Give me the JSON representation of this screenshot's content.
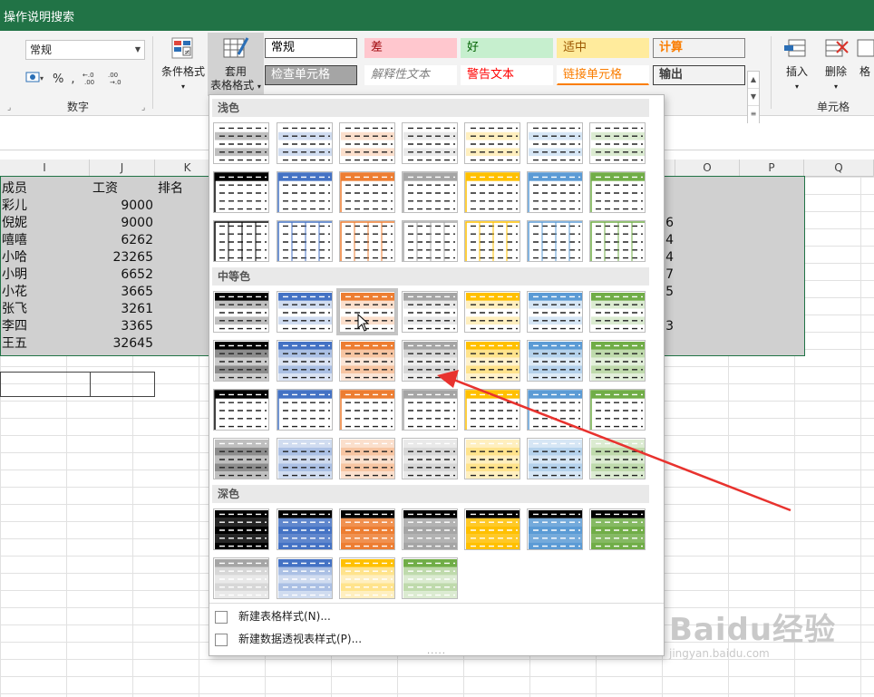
{
  "title_bar": {
    "search": "操作说明搜索"
  },
  "ribbon": {
    "number_format": "常规",
    "number_group": {
      "percent": "%",
      "comma": ",",
      "label": "数字"
    },
    "conditional_format": "条件格式",
    "table_format": [
      "套用",
      "表格格式"
    ],
    "cells_group": {
      "insert": "插入",
      "delete": "删除",
      "format": "格",
      "label": "单元格"
    },
    "cell_styles": [
      {
        "label": "常规",
        "fg": "#000000",
        "bg": "#ffffff",
        "border": "#5b5b5b"
      },
      {
        "label": "差",
        "fg": "#9c0006",
        "bg": "#ffc7ce",
        "border": "#ffc7ce"
      },
      {
        "label": "好",
        "fg": "#006100",
        "bg": "#c6efce",
        "border": "#c6efce"
      },
      {
        "label": "适中",
        "fg": "#9c5700",
        "bg": "#ffeb9c",
        "border": "#ffeb9c"
      },
      {
        "label": "计算",
        "fg": "#fa7d00",
        "bg": "#f2f2f2",
        "border": "#7f7f7f"
      },
      {
        "label": "检查单元格",
        "fg": "#ffffff",
        "bg": "#a5a5a5",
        "border": "#3f3f3f"
      },
      {
        "label": "解释性文本",
        "fg": "#7f7f7f",
        "bg": "#ffffff",
        "border": "#ffffff"
      },
      {
        "label": "警告文本",
        "fg": "#ff0000",
        "bg": "#ffffff",
        "border": "#ffffff"
      },
      {
        "label": "链接单元格",
        "fg": "#fa7d00",
        "bg": "#ffffff",
        "border": "#ffffff"
      },
      {
        "label": "输出",
        "fg": "#3f3f3f",
        "bg": "#f2f2f2",
        "border": "#3f3f3f"
      }
    ]
  },
  "sheet": {
    "columns_left": [
      "I",
      "J",
      "K"
    ],
    "columns_right": [
      "O",
      "P",
      "Q"
    ],
    "headers": [
      "成员",
      "工资",
      "排名"
    ],
    "rows": [
      {
        "name": "彩儿",
        "salary": "9000"
      },
      {
        "name": "倪妮",
        "salary": "9000"
      },
      {
        "name": "嘻嘻",
        "salary": "6262"
      },
      {
        "name": "小哈",
        "salary": "23265"
      },
      {
        "name": "小明",
        "salary": "6652"
      },
      {
        "name": "小花",
        "salary": "3665"
      },
      {
        "name": "张飞",
        "salary": "3261"
      },
      {
        "name": "李四",
        "salary": "3365"
      },
      {
        "name": "王五",
        "salary": "32645"
      }
    ],
    "partial_right_values": [
      "6",
      "4",
      "4",
      "7",
      "5",
      "",
      "3"
    ]
  },
  "table_style_panel": {
    "sections": [
      "浅色",
      "中等色",
      "深色"
    ],
    "accents": [
      "#000000",
      "#4472c4",
      "#ed7d31",
      "#a5a5a5",
      "#ffc000",
      "#5b9bd5",
      "#70ad47"
    ],
    "menu": [
      "新建表格样式(N)...",
      "新建数据透视表样式(P)..."
    ],
    "grip": "....."
  },
  "watermark": {
    "brand": "Baidu经验",
    "site": "jingyan.baidu.com"
  }
}
